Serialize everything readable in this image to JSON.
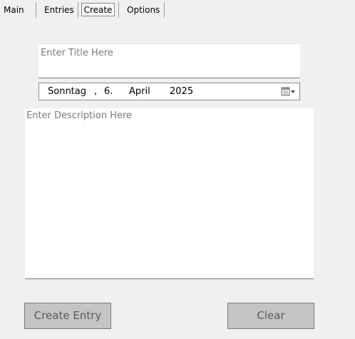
{
  "tabs": [
    {
      "label": "Main"
    },
    {
      "label": "Entries"
    },
    {
      "label": "Create"
    },
    {
      "label": "Options"
    }
  ],
  "form": {
    "title_placeholder": "Enter Title Here",
    "title_value": "",
    "date": {
      "weekday": "Sonntag",
      "comma": ",",
      "day": "6.",
      "month": "April",
      "year": "2025"
    },
    "description_placeholder": "Enter Description Here",
    "description_value": ""
  },
  "buttons": {
    "create_label": "Create Entry",
    "clear_label": "Clear"
  },
  "icons": {
    "calendar": "calendar-icon",
    "dropdown": "chevron-down-icon"
  },
  "colors": {
    "background": "#f0f0f0",
    "button_bg": "#c4c4c4",
    "button_text": "#5a5a5a",
    "placeholder": "#7a7a7a"
  }
}
